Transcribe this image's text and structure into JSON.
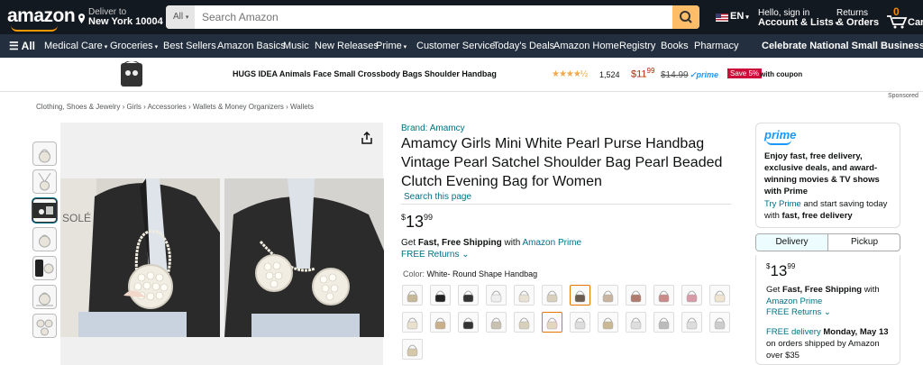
{
  "header": {
    "logo": "amazon",
    "deliver_to_label": "Deliver to",
    "deliver_to_location": "New York 10004",
    "search_category": "All",
    "search_placeholder": "Search Amazon",
    "language": "EN",
    "account_line1": "Hello, sign in",
    "account_line2": "Account & Lists",
    "returns_line1": "Returns",
    "returns_line2": "& Orders",
    "cart_count": "0",
    "cart_label": "Cart"
  },
  "nav": {
    "all_label": "All",
    "items": [
      "Medical Care",
      "Groceries",
      "Best Sellers",
      "Amazon Basics",
      "Music",
      "New Releases",
      "Prime",
      "Customer Service",
      "Today's Deals",
      "Amazon Home",
      "Registry",
      "Books",
      "Pharmacy"
    ],
    "promo": "Celebrate National Small Business Month"
  },
  "ad": {
    "title": "HUGS IDEA Animals Face Small Crossbody Bags Shoulder Handbag",
    "stars": "★★★★½",
    "rating_count": "1,524",
    "price_whole": "$11",
    "price_fraction": "99",
    "list_price": "$14.99",
    "prime": "✓prime",
    "save_badge": "Save 5%",
    "coupon": "with coupon",
    "sponsored": "Sponsored"
  },
  "breadcrumb": "Clothing, Shoes & Jewelry › Girls › Accessories › Wallets & Money Organizers › Wallets",
  "product": {
    "brand": "Brand: Amamcy",
    "title": "Amamcy Girls Mini White Pearl Purse Handbag Vintage Pearl Satchel Shoulder Bag Pearl Beaded Clutch Evening Bag for Women",
    "search_this_page": "Search this page",
    "price_currency": "$",
    "price_whole": "13",
    "price_fraction": "99",
    "shipping_prefix": "Get ",
    "shipping_bold": "Fast, Free Shipping",
    "shipping_mid": " with ",
    "shipping_link": "Amazon Prime",
    "free_returns": "FREE Returns ⌄",
    "color_label": "Color: ",
    "color_value": "White- Round Shape Handbag"
  },
  "buybox": {
    "prime_logo": "prime",
    "prime_pitch": "Enjoy fast, free delivery, exclusive deals, and award-winning movies & TV shows with Prime",
    "try_prime": "Try Prime",
    "try_prime_rest": " and start saving today with ",
    "try_prime_bold": "fast, free delivery",
    "tab_delivery": "Delivery",
    "tab_pickup": "Pickup",
    "price_whole": "13",
    "price_fraction": "99",
    "price_currency": "$",
    "ship_prefix": "Get ",
    "ship_bold": "Fast, Free Shipping",
    "ship_rest": " with ",
    "ship_link": "Amazon Prime",
    "free_returns": "FREE Returns ⌄",
    "free_delivery": "FREE delivery",
    "delivery_date": " Monday, May 13",
    "delivery_rest": "on orders shipped by Amazon over $35"
  },
  "colors": {
    "topbar": "#131921",
    "navbar": "#232f3e",
    "accent": "#ff9900",
    "link": "#007185",
    "price_red": "#b12704"
  }
}
